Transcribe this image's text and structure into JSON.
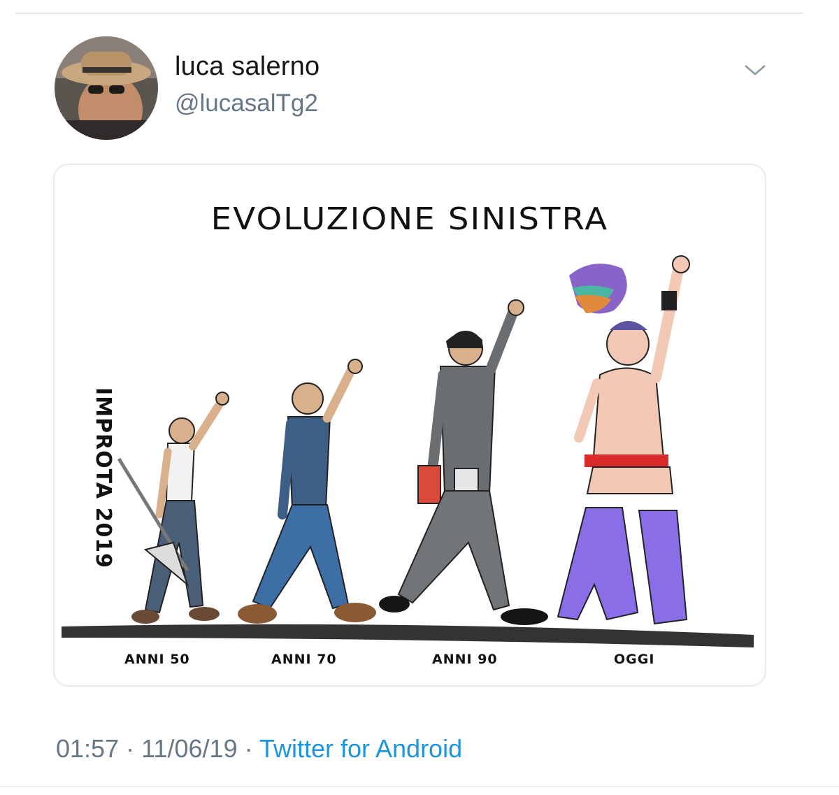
{
  "tweet": {
    "display_name": "luca salerno",
    "handle": "@lucasalTg2",
    "time": "01:57",
    "date": "11/06/19",
    "separator": "·",
    "source": "Twitter for Android",
    "menu_icon": "chevron-down-icon"
  },
  "cartoon": {
    "title": "EVOLUZIONE SINISTRA",
    "signature": "IMPROTA 2019",
    "labels": [
      "ANNI 50",
      "ANNI 70",
      "ANNI 90",
      "OGGI"
    ]
  },
  "colors": {
    "handle": "#657786",
    "link": "#1b95e0",
    "name": "#14171a"
  }
}
